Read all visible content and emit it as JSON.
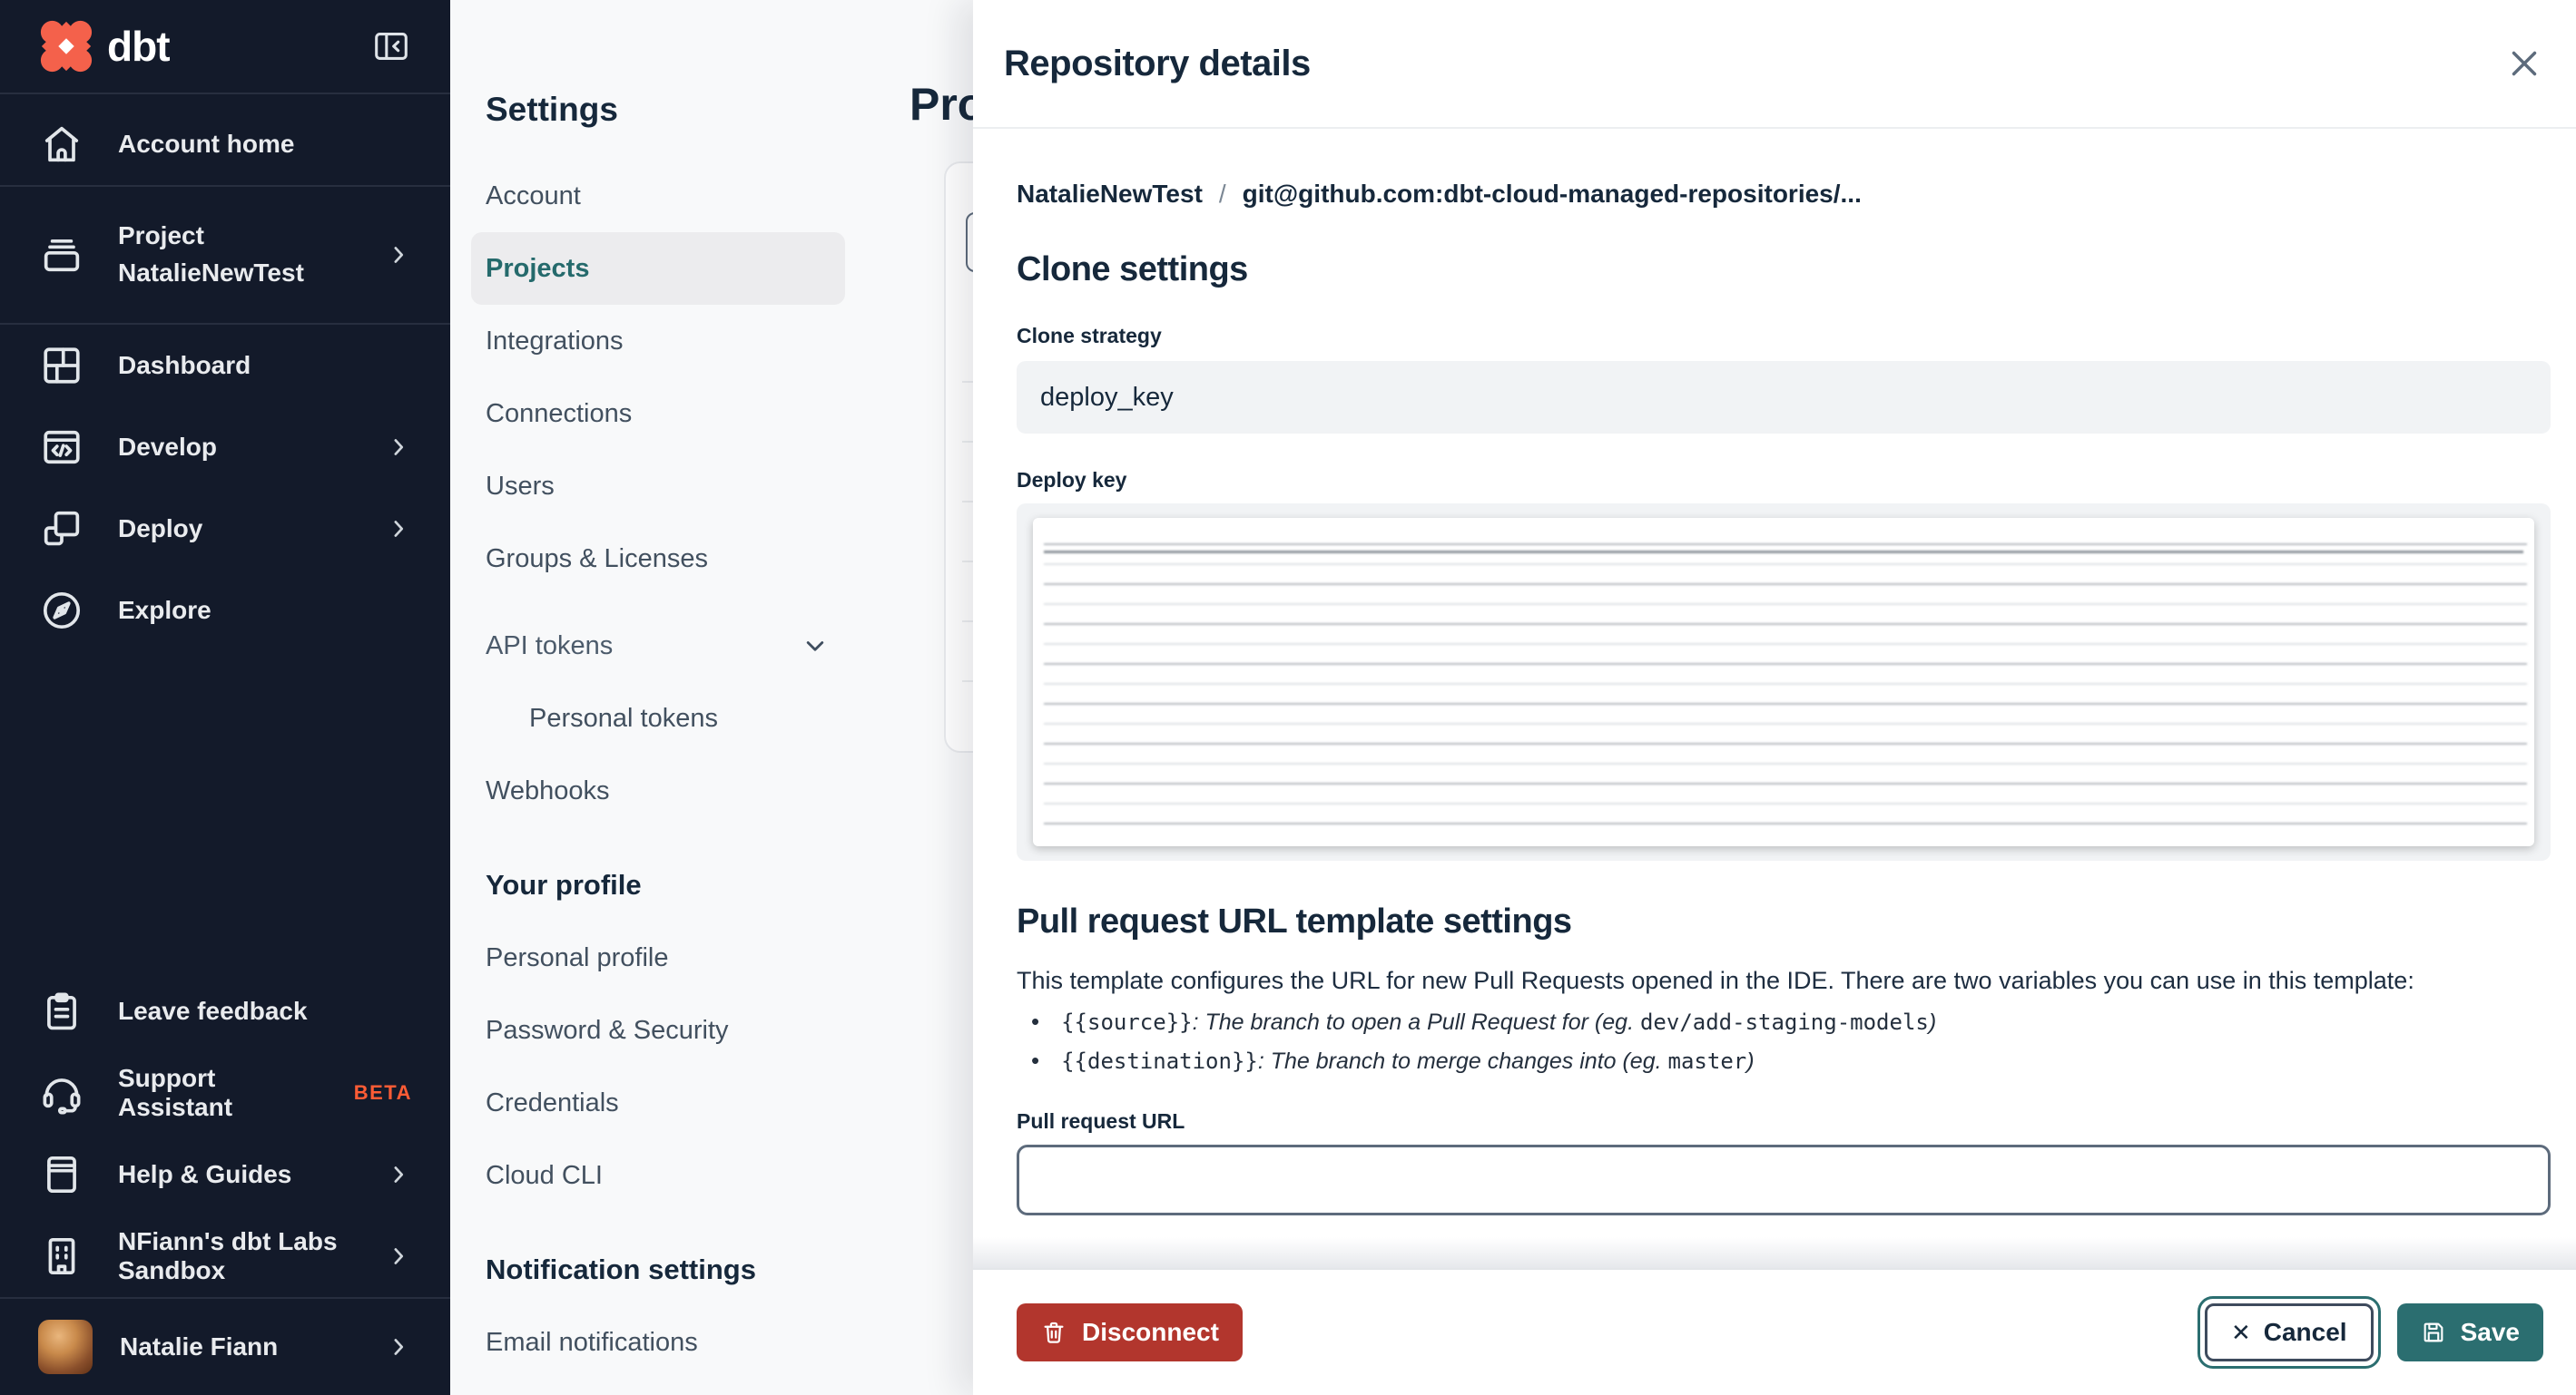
{
  "colors": {
    "brand_orange": "#f4614b",
    "accent_teal": "#2b6e70",
    "danger_red": "#b2362d",
    "sidebar_bg": "#131a2a"
  },
  "sidebar": {
    "logo_word": "dbt",
    "items": [
      {
        "label": "Account home",
        "icon": "home-icon"
      },
      {
        "label": "Project NatalieNewTest",
        "icon": "project-icon",
        "expandable": true
      },
      {
        "label": "Dashboard",
        "icon": "dashboard-icon"
      },
      {
        "label": "Develop",
        "icon": "develop-icon",
        "expandable": true
      },
      {
        "label": "Deploy",
        "icon": "deploy-icon",
        "expandable": true
      },
      {
        "label": "Explore",
        "icon": "explore-icon"
      },
      {
        "label": "Leave feedback",
        "icon": "feedback-icon"
      },
      {
        "label": "Support Assistant",
        "icon": "headset-icon",
        "badge": "BETA"
      },
      {
        "label": "Help & Guides",
        "icon": "book-icon",
        "expandable": true
      },
      {
        "label": "NFiann's dbt Labs Sandbox",
        "icon": "building-icon",
        "expandable": true
      }
    ],
    "user": {
      "name": "Natalie Fiann"
    }
  },
  "settings_nav": {
    "title": "Settings",
    "items": [
      {
        "label": "Account"
      },
      {
        "label": "Projects",
        "active": true
      },
      {
        "label": "Integrations"
      },
      {
        "label": "Connections"
      },
      {
        "label": "Users"
      },
      {
        "label": "Groups & Licenses"
      },
      {
        "label": "API tokens",
        "expandable": true
      },
      {
        "label": "Personal tokens",
        "indent": true
      },
      {
        "label": "Webhooks"
      }
    ],
    "profile_section": {
      "title": "Your profile",
      "items": [
        "Personal profile",
        "Password & Security",
        "Credentials",
        "Cloud CLI"
      ]
    },
    "notification_section": {
      "title": "Notification settings",
      "items": [
        "Email notifications"
      ]
    }
  },
  "background_page": {
    "title": "Projects"
  },
  "panel": {
    "title": "Repository details",
    "breadcrumb": {
      "project": "NatalieNewTest",
      "separator": "/",
      "repo": "git@github.com:dbt-cloud-managed-repositories/..."
    },
    "clone_settings": {
      "heading": "Clone settings",
      "strategy_label": "Clone strategy",
      "strategy_value": "deploy_key",
      "deploy_key_label": "Deploy key"
    },
    "pr_template": {
      "heading": "Pull request URL template settings",
      "description": "This template configures the URL for new Pull Requests opened in the IDE. There are two variables you can use in this template:",
      "bullets": [
        {
          "variable": "{{source}}",
          "description": ": The branch to open a Pull Request for (eg. ",
          "example": "dev/add-staging-models",
          "closing": ")"
        },
        {
          "variable": "{{destination}}",
          "description": ": The branch to merge changes into (eg. ",
          "example": "master",
          "closing": ")"
        }
      ]
    },
    "pr_url": {
      "label": "Pull request URL",
      "value": ""
    },
    "footer": {
      "disconnect": "Disconnect",
      "cancel": "Cancel",
      "save": "Save"
    }
  }
}
